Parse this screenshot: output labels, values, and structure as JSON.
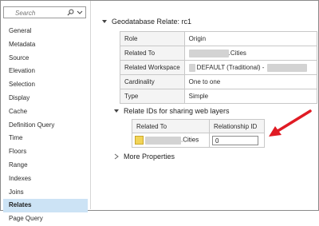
{
  "search": {
    "placeholder": "Search"
  },
  "sidebar": {
    "items": [
      {
        "label": "General"
      },
      {
        "label": "Metadata"
      },
      {
        "label": "Source"
      },
      {
        "label": "Elevation"
      },
      {
        "label": "Selection"
      },
      {
        "label": "Display"
      },
      {
        "label": "Cache"
      },
      {
        "label": "Definition Query"
      },
      {
        "label": "Time"
      },
      {
        "label": "Floors"
      },
      {
        "label": "Range"
      },
      {
        "label": "Indexes"
      },
      {
        "label": "Joins"
      },
      {
        "label": "Relates",
        "selected": true
      },
      {
        "label": "Page Query"
      }
    ]
  },
  "main": {
    "section_title": "Geodatabase Relate: rc1",
    "properties": [
      {
        "key": "Role",
        "value": "Origin"
      },
      {
        "key": "Related To",
        "value": ".Cities"
      },
      {
        "key": "Related Workspace",
        "value": "DEFAULT (Traditional) -"
      },
      {
        "key": "Cardinality",
        "value": "One to one"
      },
      {
        "key": "Type",
        "value": "Simple"
      }
    ],
    "relate_section_title": "Relate IDs for sharing web layers",
    "relate_table": {
      "headers": [
        "Related To",
        "Relationship ID"
      ],
      "row": {
        "related_to": ".Cities",
        "relationship_id": "0"
      }
    },
    "more_properties_label": "More Properties"
  },
  "colors": {
    "selected_bg": "#cce3f5",
    "arrow": "#e01b24",
    "table_icon": "#f2d457"
  }
}
